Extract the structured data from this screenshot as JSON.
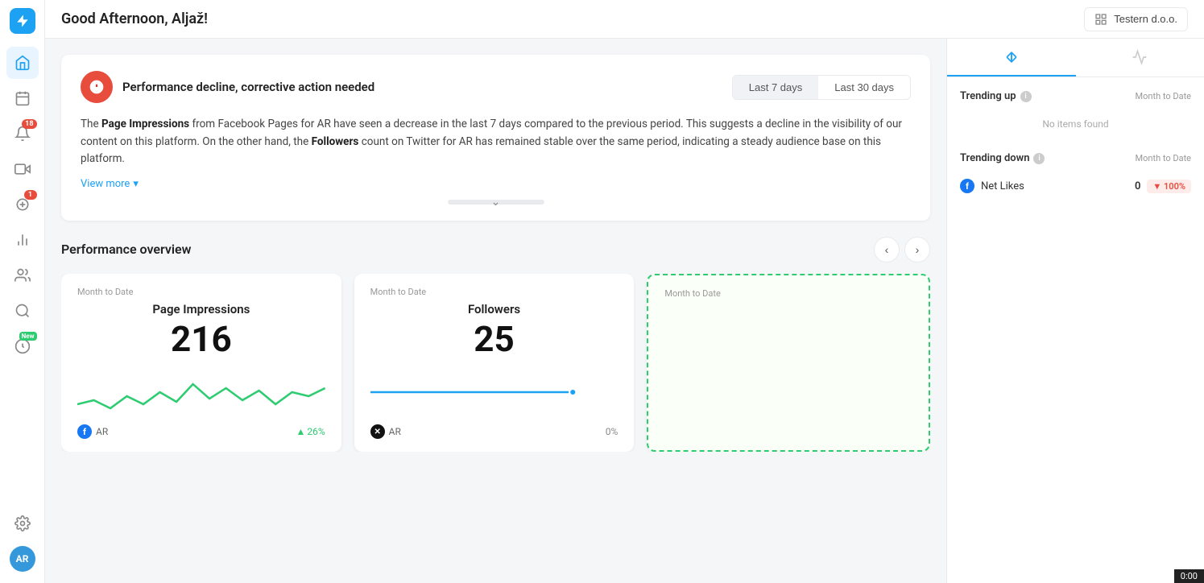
{
  "header": {
    "greeting": "Good Afternoon, Aljaž!",
    "workspace": "Testern d.o.o."
  },
  "sidebar": {
    "logo_label": "App Logo",
    "items": [
      {
        "id": "home",
        "icon": "home",
        "active": true,
        "badge": null
      },
      {
        "id": "calendar",
        "icon": "calendar",
        "active": false,
        "badge": null
      },
      {
        "id": "notifications",
        "icon": "bell",
        "active": false,
        "badge": "18"
      },
      {
        "id": "video",
        "icon": "video",
        "active": false,
        "badge": null
      },
      {
        "id": "coins",
        "icon": "coins",
        "active": false,
        "badge": "1"
      },
      {
        "id": "analytics",
        "icon": "chart",
        "active": false,
        "badge": null
      },
      {
        "id": "audience",
        "icon": "users",
        "active": false,
        "badge": null
      },
      {
        "id": "search",
        "icon": "search",
        "active": false,
        "badge": null
      },
      {
        "id": "new-feature",
        "icon": "lightning",
        "active": false,
        "badge": "New"
      }
    ],
    "bottom_items": [
      {
        "id": "settings",
        "icon": "gear"
      },
      {
        "id": "avatar",
        "initials": "AR"
      }
    ]
  },
  "alert": {
    "title": "Performance decline, corrective action needed",
    "body_text": "The ",
    "metric1": "Page Impressions",
    "body_mid1": " from Facebook Pages for AR have seen a decrease in the last 7 days compared to the previous period. This suggests a decline in the visibility of our content on this platform. On the other hand, the ",
    "metric2": "Followers",
    "body_mid2": " count on Twitter for AR has remained stable over the same period, indicating a steady audience base on this platform.",
    "view_more": "View more",
    "date_tabs": [
      {
        "label": "Last 7 days",
        "active": true
      },
      {
        "label": "Last 30 days",
        "active": false
      }
    ]
  },
  "performance": {
    "section_title": "Performance overview",
    "cards": [
      {
        "id": "page-impressions",
        "period": "Month to Date",
        "name": "Page Impressions",
        "value": "216",
        "platform": "AR",
        "platform_icon": "facebook",
        "change": "26%",
        "change_direction": "up"
      },
      {
        "id": "followers",
        "period": "Month to Date",
        "name": "Followers",
        "value": "25",
        "platform": "AR",
        "platform_icon": "twitter",
        "change": "0%",
        "change_direction": "neutral"
      },
      {
        "id": "third",
        "period": "Month to Date",
        "name": "",
        "value": "",
        "platform": "",
        "dashed": true
      }
    ]
  },
  "right_panel": {
    "tabs": [
      {
        "id": "sort",
        "icon": "↕",
        "active": true
      },
      {
        "id": "pulse",
        "icon": "⚡",
        "active": false
      }
    ],
    "trending_up": {
      "title": "Trending up",
      "date_label": "Month to Date",
      "no_items_text": "No items found"
    },
    "trending_down": {
      "title": "Trending down",
      "date_label": "Month to Date",
      "items": [
        {
          "platform_icon": "facebook",
          "metric": "Net Likes",
          "value": "0",
          "change": "▼ 100%",
          "change_type": "down"
        }
      ]
    }
  },
  "status_bar": {
    "time": "0:00"
  }
}
